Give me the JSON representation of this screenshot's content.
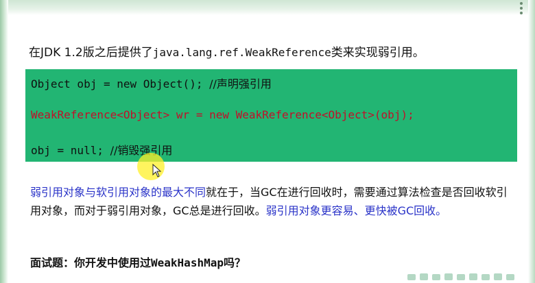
{
  "intro": {
    "prefix": "在JDK 1.2版之后提供了",
    "class_name": "java.lang.ref.WeakReference",
    "suffix": "类来实现弱引用。"
  },
  "code": {
    "line1": {
      "code": "Object obj = new Object(); ",
      "comment": "//声明强引用"
    },
    "line2": {
      "code": "WeakReference<Object> wr = new WeakReference<Object>(obj);"
    },
    "line3": {
      "code": "obj = null; ",
      "comment": "//销毁强引用"
    }
  },
  "paragraph": {
    "highlight1": "弱引用对象与软引用对象的最大不同",
    "text": "就在于，当GC在进行回收时，需要通过算法检查是否回收软引用对象，而对于弱引用对象，GC总是进行回收。",
    "highlight2": "弱引用对象更容易、更快被GC回收。"
  },
  "question": {
    "prefix": "面试题：你开发中使用过",
    "class_name": "WeakHashMap",
    "suffix": "吗？"
  },
  "colors": {
    "code_background": "#22b573",
    "code_red": "#c0102a",
    "highlight_blue": "#2a33c8",
    "cursor_yellow": "#fff028"
  }
}
